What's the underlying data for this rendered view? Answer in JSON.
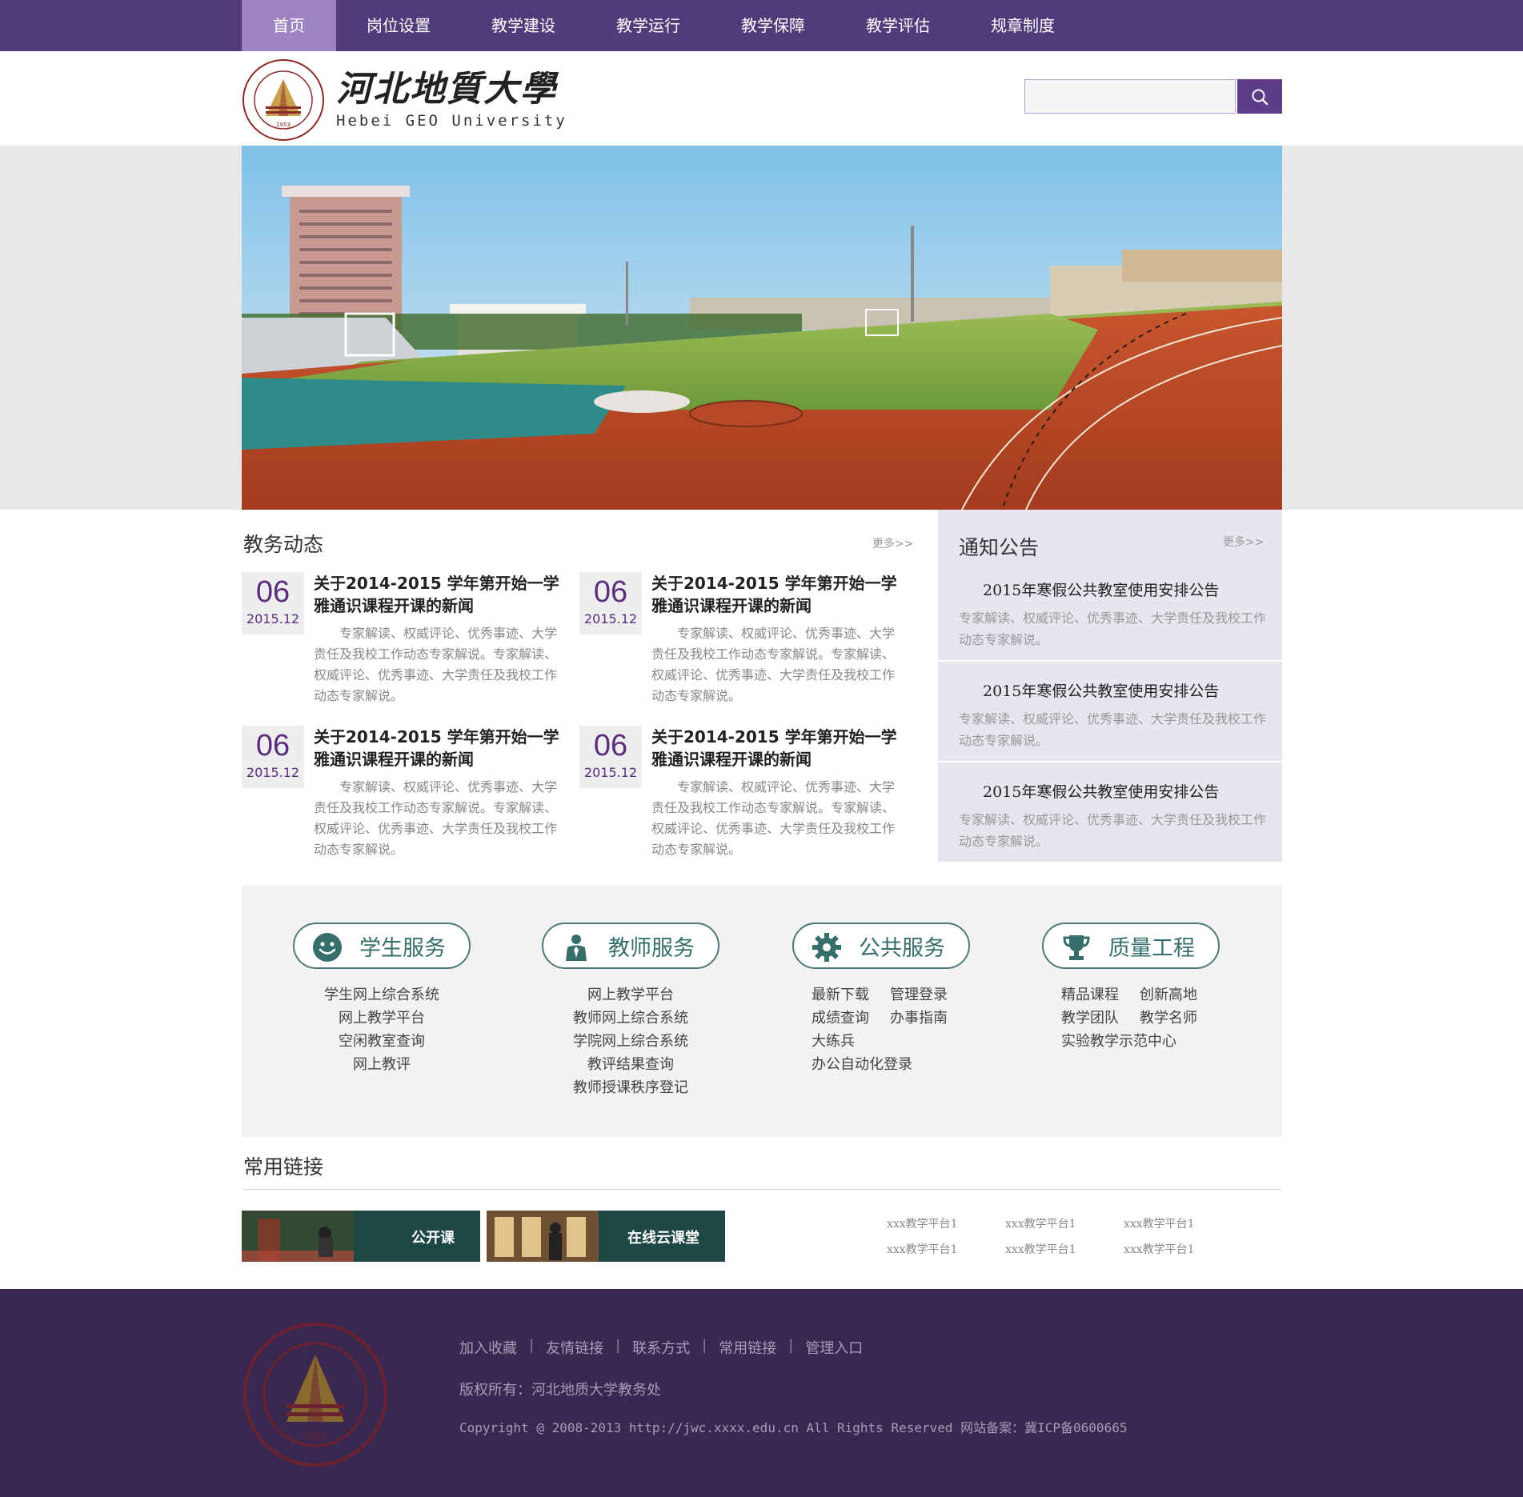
{
  "nav": {
    "items": [
      {
        "label": "首页",
        "active": true
      },
      {
        "label": "岗位设置"
      },
      {
        "label": "教学建设"
      },
      {
        "label": "教学运行"
      },
      {
        "label": "教学保障"
      },
      {
        "label": "教学评估"
      },
      {
        "label": "规章制度"
      }
    ]
  },
  "logo": {
    "cn": "河北地質大學",
    "en": "Hebei GEO University"
  },
  "search": {
    "placeholder": "",
    "value": ""
  },
  "news": {
    "title": "教务动态",
    "more": "更多>>",
    "items": [
      {
        "day": "06",
        "ym": "2015.12",
        "title": "关于2014-2015 学年第开始一学雅通识课程开课的新闻",
        "desc": "专家解读、权威评论、优秀事迹、大学责任及我校工作动态专家解说。专家解读、权威评论、优秀事迹、大学责任及我校工作动态专家解说。"
      },
      {
        "day": "06",
        "ym": "2015.12",
        "title": "关于2014-2015 学年第开始一学雅通识课程开课的新闻",
        "desc": "专家解读、权威评论、优秀事迹、大学责任及我校工作动态专家解说。专家解读、权威评论、优秀事迹、大学责任及我校工作动态专家解说。"
      },
      {
        "day": "06",
        "ym": "2015.12",
        "title": "关于2014-2015 学年第开始一学雅通识课程开课的新闻",
        "desc": "专家解读、权威评论、优秀事迹、大学责任及我校工作动态专家解说。专家解读、权威评论、优秀事迹、大学责任及我校工作动态专家解说。"
      },
      {
        "day": "06",
        "ym": "2015.12",
        "title": "关于2014-2015 学年第开始一学雅通识课程开课的新闻",
        "desc": "专家解读、权威评论、优秀事迹、大学责任及我校工作动态专家解说。专家解读、权威评论、优秀事迹、大学责任及我校工作动态专家解说。"
      }
    ]
  },
  "notice": {
    "title": "通知公告",
    "more": "更多>>",
    "items": [
      {
        "title": "2015年寒假公共教室使用安排公告",
        "desc": "专家解读、权威评论、优秀事迹、大学责任及我校工作动态专家解说。"
      },
      {
        "title": "2015年寒假公共教室使用安排公告",
        "desc": "专家解读、权威评论、优秀事迹、大学责任及我校工作动态专家解说。"
      },
      {
        "title": "2015年寒假公共教室使用安排公告",
        "desc": "专家解读、权威评论、优秀事迹、大学责任及我校工作动态专家解说。"
      }
    ]
  },
  "services": [
    {
      "label": "学生服务",
      "icon": "smiley-icon",
      "links": [
        "学生网上综合系统",
        "网上教学平台",
        "空闲教室查询",
        "网上教评"
      ]
    },
    {
      "label": "教师服务",
      "icon": "teacher-icon",
      "links": [
        "网上教学平台",
        "教师网上综合系统",
        "学院网上综合系统",
        "教评结果查询",
        "教师授课秩序登记"
      ]
    },
    {
      "label": "公共服务",
      "icon": "gear-icon",
      "links": [
        "最新下载",
        "管理登录",
        "成绩查询",
        "办事指南",
        "大练兵",
        "",
        "办公自动化登录"
      ]
    },
    {
      "label": "质量工程",
      "icon": "trophy-icon",
      "links": [
        "精品课程",
        "创新高地",
        "教学团队",
        "教学名师",
        "实验教学示范中心"
      ]
    }
  ],
  "common": {
    "title": "常用链接",
    "cards": [
      "公开课",
      "在线云课堂"
    ],
    "platforms": [
      "xxx教学平台1",
      "xxx教学平台1",
      "xxx教学平台1",
      "xxx教学平台1",
      "xxx教学平台1",
      "xxx教学平台1"
    ]
  },
  "footer": {
    "links": [
      "加入收藏",
      "友情链接",
      "联系方式",
      "常用链接",
      "管理入口"
    ],
    "copyright": "版权所有：河北地质大学教务处",
    "copyright2": "Copyright @ 2008-2013 http://jwc.xxxx.edu.cn All Rights Reserved 网站备案：冀ICP备0600665"
  },
  "colors": {
    "brand": "#523b7b",
    "accent": "#9c83c2",
    "teal": "#356e6b",
    "footer": "#3b2850"
  }
}
